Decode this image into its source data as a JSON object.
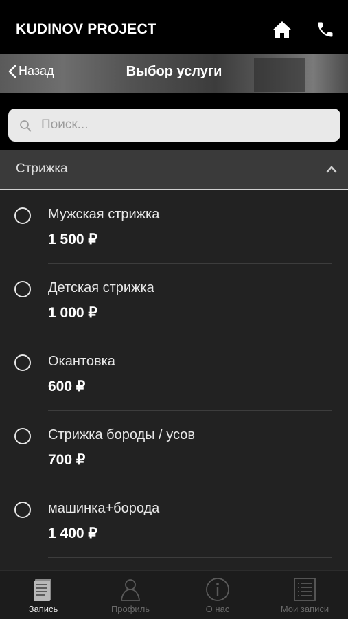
{
  "header": {
    "brand": "KUDINOV PROJECT",
    "home_icon": "home-icon",
    "phone_icon": "phone-icon"
  },
  "nav": {
    "back_label": "Назад",
    "title": "Выбор услуги"
  },
  "search": {
    "placeholder": "Поиск..."
  },
  "category": {
    "label": "Стрижка"
  },
  "services": [
    {
      "name": "Мужская стрижка",
      "price": "1 500 ₽"
    },
    {
      "name": "Детская стрижка",
      "price": "1 000 ₽"
    },
    {
      "name": "Окантовка",
      "price": "600 ₽"
    },
    {
      "name": "Стрижка бороды / усов",
      "price": "700 ₽"
    },
    {
      "name": "машинка+борода",
      "price": "1 400 ₽"
    }
  ],
  "tabs": [
    {
      "label": "Запись",
      "icon": "document-icon",
      "active": true
    },
    {
      "label": "Профиль",
      "icon": "person-icon",
      "active": false
    },
    {
      "label": "О нас",
      "icon": "info-icon",
      "active": false
    },
    {
      "label": "Мои записи",
      "icon": "list-icon",
      "active": false
    }
  ],
  "colors": {
    "background": "#222222",
    "topbar": "#000000",
    "active_tab": "#e6e6e6",
    "inactive_tab": "#6a6a6a"
  }
}
